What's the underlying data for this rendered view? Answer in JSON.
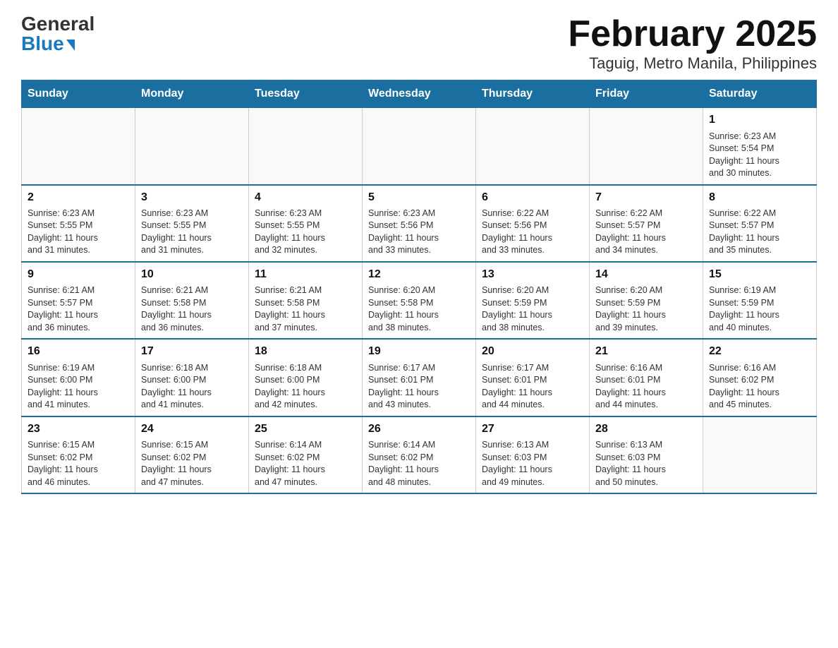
{
  "header": {
    "logo_general": "General",
    "logo_blue": "Blue",
    "title": "February 2025",
    "subtitle": "Taguig, Metro Manila, Philippines"
  },
  "calendar": {
    "days_of_week": [
      "Sunday",
      "Monday",
      "Tuesday",
      "Wednesday",
      "Thursday",
      "Friday",
      "Saturday"
    ],
    "weeks": [
      [
        {
          "day": "",
          "info": ""
        },
        {
          "day": "",
          "info": ""
        },
        {
          "day": "",
          "info": ""
        },
        {
          "day": "",
          "info": ""
        },
        {
          "day": "",
          "info": ""
        },
        {
          "day": "",
          "info": ""
        },
        {
          "day": "1",
          "info": "Sunrise: 6:23 AM\nSunset: 5:54 PM\nDaylight: 11 hours\nand 30 minutes."
        }
      ],
      [
        {
          "day": "2",
          "info": "Sunrise: 6:23 AM\nSunset: 5:55 PM\nDaylight: 11 hours\nand 31 minutes."
        },
        {
          "day": "3",
          "info": "Sunrise: 6:23 AM\nSunset: 5:55 PM\nDaylight: 11 hours\nand 31 minutes."
        },
        {
          "day": "4",
          "info": "Sunrise: 6:23 AM\nSunset: 5:55 PM\nDaylight: 11 hours\nand 32 minutes."
        },
        {
          "day": "5",
          "info": "Sunrise: 6:23 AM\nSunset: 5:56 PM\nDaylight: 11 hours\nand 33 minutes."
        },
        {
          "day": "6",
          "info": "Sunrise: 6:22 AM\nSunset: 5:56 PM\nDaylight: 11 hours\nand 33 minutes."
        },
        {
          "day": "7",
          "info": "Sunrise: 6:22 AM\nSunset: 5:57 PM\nDaylight: 11 hours\nand 34 minutes."
        },
        {
          "day": "8",
          "info": "Sunrise: 6:22 AM\nSunset: 5:57 PM\nDaylight: 11 hours\nand 35 minutes."
        }
      ],
      [
        {
          "day": "9",
          "info": "Sunrise: 6:21 AM\nSunset: 5:57 PM\nDaylight: 11 hours\nand 36 minutes."
        },
        {
          "day": "10",
          "info": "Sunrise: 6:21 AM\nSunset: 5:58 PM\nDaylight: 11 hours\nand 36 minutes."
        },
        {
          "day": "11",
          "info": "Sunrise: 6:21 AM\nSunset: 5:58 PM\nDaylight: 11 hours\nand 37 minutes."
        },
        {
          "day": "12",
          "info": "Sunrise: 6:20 AM\nSunset: 5:58 PM\nDaylight: 11 hours\nand 38 minutes."
        },
        {
          "day": "13",
          "info": "Sunrise: 6:20 AM\nSunset: 5:59 PM\nDaylight: 11 hours\nand 38 minutes."
        },
        {
          "day": "14",
          "info": "Sunrise: 6:20 AM\nSunset: 5:59 PM\nDaylight: 11 hours\nand 39 minutes."
        },
        {
          "day": "15",
          "info": "Sunrise: 6:19 AM\nSunset: 5:59 PM\nDaylight: 11 hours\nand 40 minutes."
        }
      ],
      [
        {
          "day": "16",
          "info": "Sunrise: 6:19 AM\nSunset: 6:00 PM\nDaylight: 11 hours\nand 41 minutes."
        },
        {
          "day": "17",
          "info": "Sunrise: 6:18 AM\nSunset: 6:00 PM\nDaylight: 11 hours\nand 41 minutes."
        },
        {
          "day": "18",
          "info": "Sunrise: 6:18 AM\nSunset: 6:00 PM\nDaylight: 11 hours\nand 42 minutes."
        },
        {
          "day": "19",
          "info": "Sunrise: 6:17 AM\nSunset: 6:01 PM\nDaylight: 11 hours\nand 43 minutes."
        },
        {
          "day": "20",
          "info": "Sunrise: 6:17 AM\nSunset: 6:01 PM\nDaylight: 11 hours\nand 44 minutes."
        },
        {
          "day": "21",
          "info": "Sunrise: 6:16 AM\nSunset: 6:01 PM\nDaylight: 11 hours\nand 44 minutes."
        },
        {
          "day": "22",
          "info": "Sunrise: 6:16 AM\nSunset: 6:02 PM\nDaylight: 11 hours\nand 45 minutes."
        }
      ],
      [
        {
          "day": "23",
          "info": "Sunrise: 6:15 AM\nSunset: 6:02 PM\nDaylight: 11 hours\nand 46 minutes."
        },
        {
          "day": "24",
          "info": "Sunrise: 6:15 AM\nSunset: 6:02 PM\nDaylight: 11 hours\nand 47 minutes."
        },
        {
          "day": "25",
          "info": "Sunrise: 6:14 AM\nSunset: 6:02 PM\nDaylight: 11 hours\nand 47 minutes."
        },
        {
          "day": "26",
          "info": "Sunrise: 6:14 AM\nSunset: 6:02 PM\nDaylight: 11 hours\nand 48 minutes."
        },
        {
          "day": "27",
          "info": "Sunrise: 6:13 AM\nSunset: 6:03 PM\nDaylight: 11 hours\nand 49 minutes."
        },
        {
          "day": "28",
          "info": "Sunrise: 6:13 AM\nSunset: 6:03 PM\nDaylight: 11 hours\nand 50 minutes."
        },
        {
          "day": "",
          "info": ""
        }
      ]
    ]
  }
}
